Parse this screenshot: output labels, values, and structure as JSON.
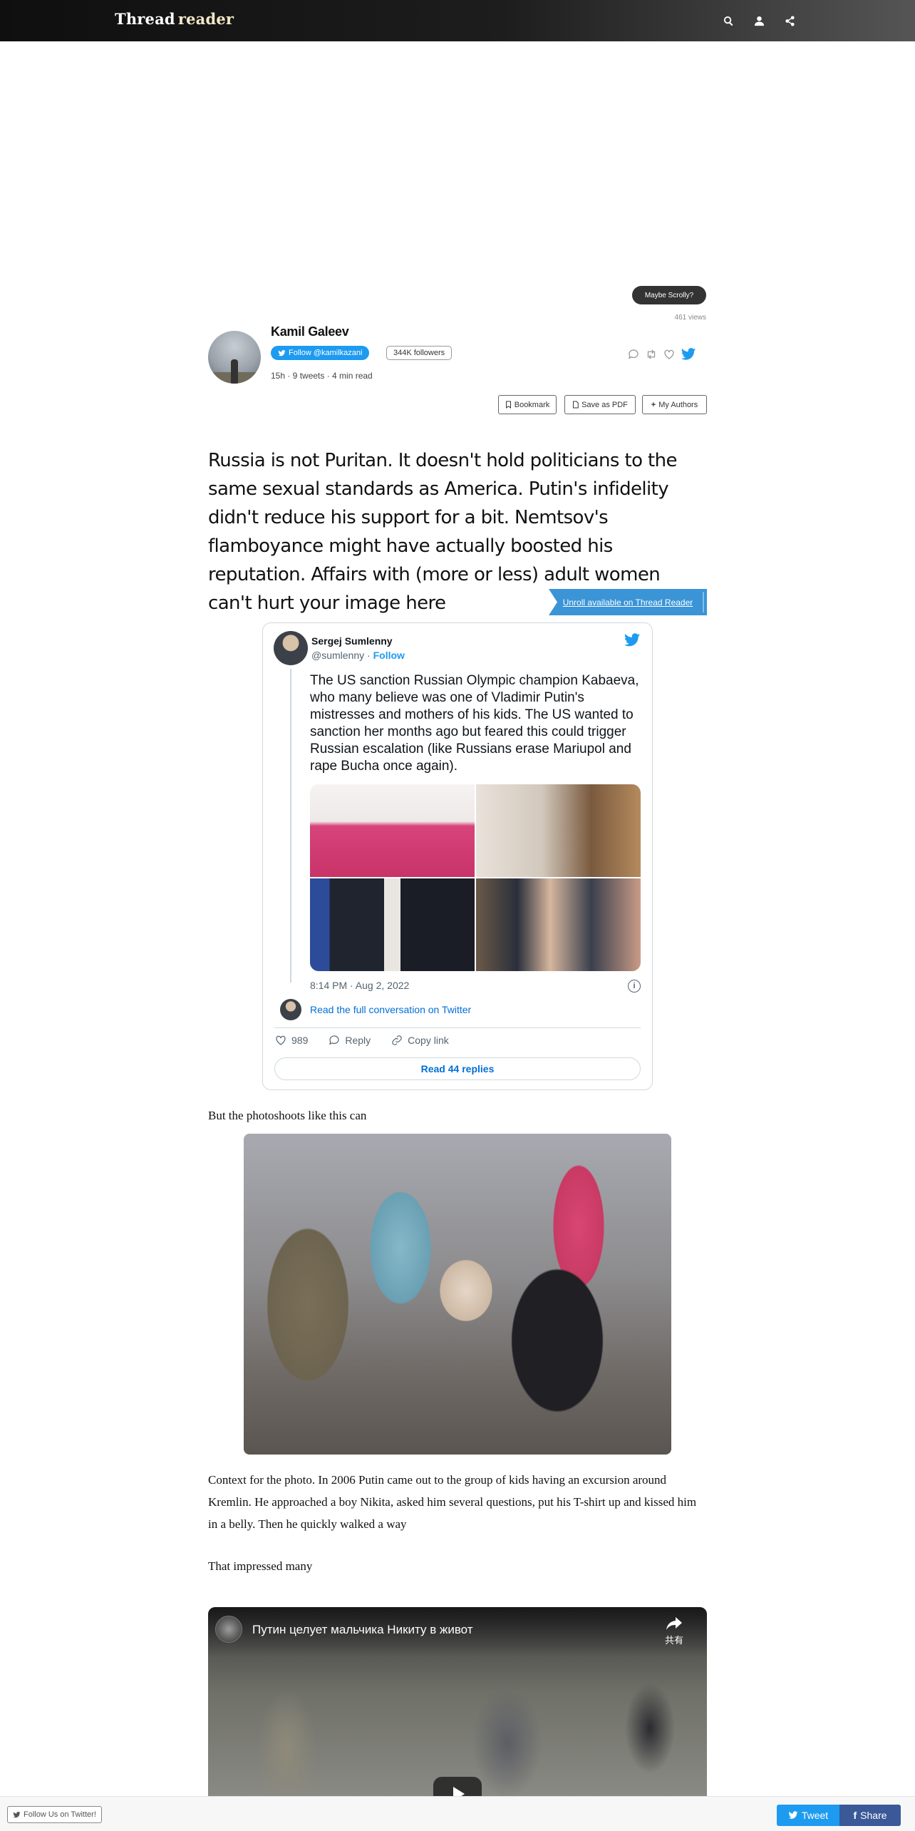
{
  "header": {
    "brand_part1": "Thread",
    "brand_part2": "reader",
    "icons": [
      "search-icon",
      "user-icon",
      "share-icon"
    ]
  },
  "scrolly_label": "Maybe Scrolly?",
  "views": "461 views",
  "author": {
    "name": "Kamil Galeev",
    "follow_label": "Follow @kamilkazani",
    "followers": "344K followers",
    "meta": "15h · 9 tweets · 4 min read"
  },
  "toolbar": {
    "bookmark": "Bookmark",
    "save_pdf": "Save as PDF",
    "my_authors": "My Authors"
  },
  "thread": {
    "lead": "Russia is not Puritan. It doesn't hold politicians to the same sexual standards as America. Putin's infidelity didn't reduce his support for a bit. Nemtsov's flamboyance might have actually boosted his reputation. Affairs with (more or less) adult women can't hurt your image here",
    "unroll": "Unroll available on Thread Reader",
    "para2": "But the photoshoots like this can",
    "para3": "Context for the photo. In 2006 Putin came out to the group of kids having an excursion around Kremlin. He approached a boy Nikita, asked him several questions, put his T-shirt up and kissed him in a belly. Then he quickly walked a way",
    "para4": "That impressed many"
  },
  "embedded_tweet": {
    "name": "Sergej Sumlenny",
    "handle": "@sumlenny",
    "follow": "Follow",
    "text": "The US sanction Russian Olympic champion Kabaeva, who many believe was one of Vladimir Putin's mistresses and mothers of his kids. The US wanted to sanction her months ago but feared this could trigger Russian escalation (like Russians erase Mariupol and rape Bucha once again).",
    "time": "8:14 PM · Aug 2, 2022",
    "read_full": "Read the full conversation on Twitter",
    "likes": "989",
    "reply": "Reply",
    "copy_link": "Copy link",
    "read_replies": "Read 44 replies"
  },
  "video": {
    "title": "Путин целует мальчика Никиту в живот",
    "share": "共有"
  },
  "footer": {
    "follow_us": "Follow Us on Twitter!",
    "tweet": "Tweet",
    "share": "Share"
  },
  "colors": {
    "twitter_blue": "#1d9bf0",
    "facebook_blue": "#3b5998",
    "unroll_blue": "#3a94d6"
  }
}
